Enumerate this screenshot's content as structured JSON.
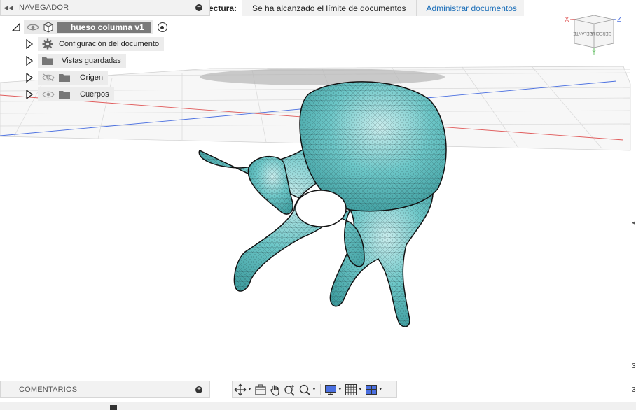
{
  "banner": {
    "label": "ectura:",
    "message": "Se ha alcanzado el límite de documentos",
    "link": "Administrar documentos"
  },
  "navigator": {
    "title": "NAVEGADOR",
    "root": {
      "name": "hueso columna v1"
    },
    "items": [
      {
        "label": "Configuración del documento",
        "icon": "gear-icon"
      },
      {
        "label": "Vistas guardadas",
        "icon": "folder-icon"
      },
      {
        "label": "Origen",
        "icon": "folder-icon",
        "visibility": "hidden-eye-icon"
      },
      {
        "label": "Cuerpos",
        "icon": "folder-icon",
        "visibility": "eye-icon"
      }
    ]
  },
  "comments": {
    "title": "COMENTARIOS"
  },
  "viewcube": {
    "front_label": "DELANTE",
    "right_label": "DERECHA",
    "axis_x": "X",
    "axis_y": "Y",
    "axis_z": "Z"
  },
  "toolbar": {
    "tools": [
      "orbit-icon",
      "look-at-icon",
      "pan-icon",
      "zoom-icon",
      "fit-icon",
      "display-settings-icon",
      "grid-icon",
      "viewports-icon"
    ]
  },
  "edge_numbers": [
    "3",
    "3"
  ],
  "colors": {
    "bone_fill": "#62c0c2",
    "root_chip": "#7a7a7a",
    "link": "#1c6fb9",
    "axis_red": "#e05a5a",
    "axis_blue": "#4a6fe0",
    "axis_green": "#5dbb5d"
  }
}
